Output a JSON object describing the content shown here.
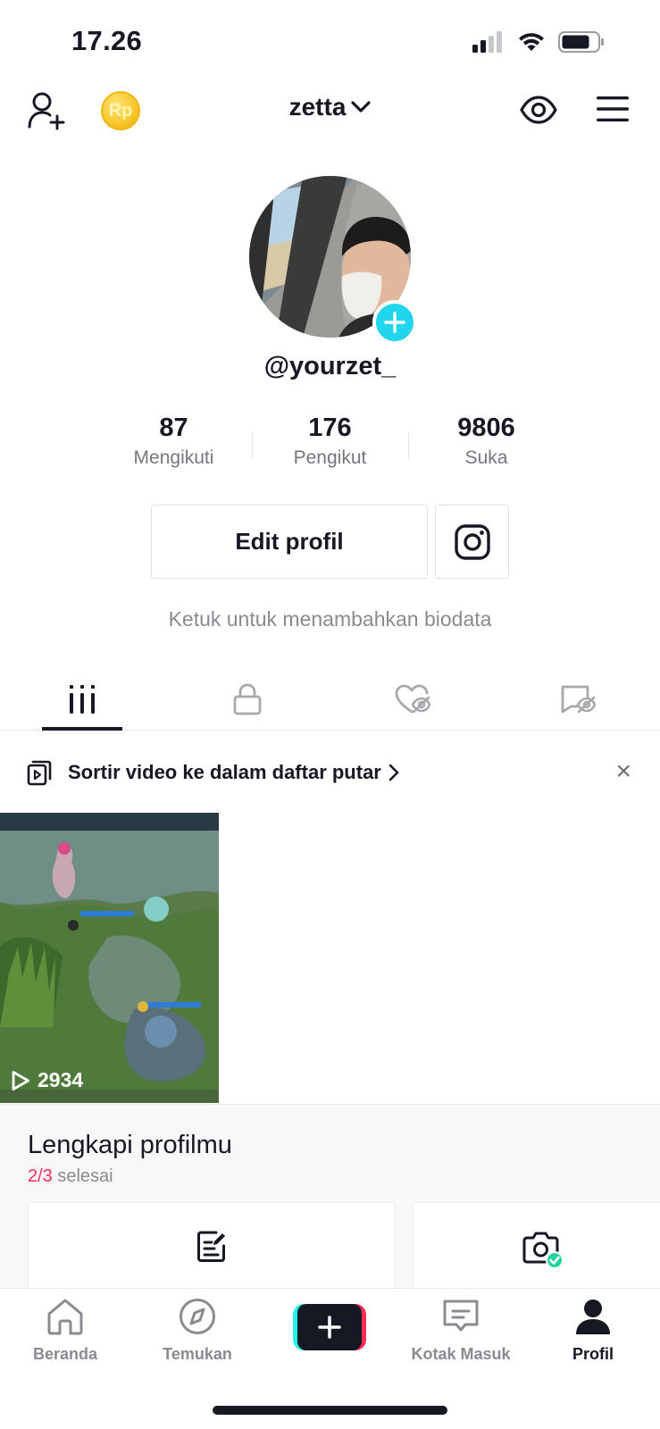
{
  "status_bar": {
    "time": "17.26"
  },
  "top_bar": {
    "coin_label": "Rp",
    "username": "zetta"
  },
  "profile": {
    "handle": "@yourzet_",
    "stats": [
      {
        "value": "87",
        "label": "Mengikuti"
      },
      {
        "value": "176",
        "label": "Pengikut"
      },
      {
        "value": "9806",
        "label": "Suka"
      }
    ],
    "edit_label": "Edit profil",
    "bio_placeholder": "Ketuk untuk menambahkan biodata"
  },
  "tabs": [
    {
      "icon": "grid-icon",
      "active": true
    },
    {
      "icon": "lock-icon",
      "active": false
    },
    {
      "icon": "liked-hidden-icon",
      "active": false
    },
    {
      "icon": "tagged-hidden-icon",
      "active": false
    }
  ],
  "banner": {
    "text": "Sortir video ke dalam daftar putar",
    "close": "×"
  },
  "videos": [
    {
      "views": "2934"
    }
  ],
  "complete_profile": {
    "title": "Lengkapi profilmu",
    "progress_done": "2/3",
    "progress_suffix": " selesai"
  },
  "bottom_nav": [
    {
      "label": "Beranda",
      "icon": "home-icon",
      "active": false
    },
    {
      "label": "Temukan",
      "icon": "compass-icon",
      "active": false
    },
    {
      "label": "",
      "icon": "create-icon",
      "active": false
    },
    {
      "label": "Kotak Masuk",
      "icon": "inbox-icon",
      "active": false
    },
    {
      "label": "Profil",
      "icon": "profile-icon",
      "active": true
    }
  ],
  "colors": {
    "accent": "#fe2c55",
    "cyan": "#25f4ee",
    "avatar_plus": "#20d5ec",
    "text": "#161823",
    "muted": "#8a8b91"
  }
}
